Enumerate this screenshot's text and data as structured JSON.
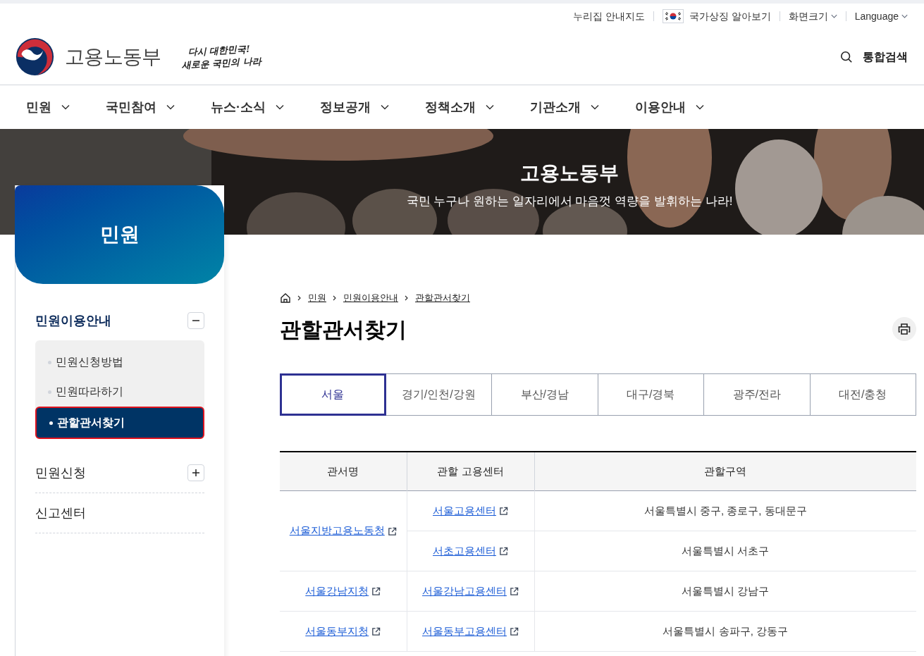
{
  "utility_bar": {
    "links": [
      {
        "label": "누리집 안내지도",
        "kind": "plain"
      },
      {
        "label": "국가상징 알아보기",
        "kind": "flag"
      },
      {
        "label": "화면크기",
        "kind": "dropdown"
      },
      {
        "label": "Language",
        "kind": "dropdown"
      }
    ]
  },
  "header": {
    "logo_text": "고용노동부",
    "slogan": [
      "다시 대한민국!",
      "새로운 국민의 나라"
    ],
    "search_label": "통합검색"
  },
  "nav": [
    "민원",
    "국민참여",
    "뉴스·소식",
    "정보공개",
    "정책소개",
    "기관소개",
    "이용안내"
  ],
  "hero": {
    "title": "고용노동부",
    "subtitle": "국민 누구나 원하는 일자리에서 마음껏 역량을 발휘하는 나라!"
  },
  "sidebar": {
    "title": "민원",
    "items": [
      {
        "label": "민원이용안내",
        "expanded": true,
        "children": [
          {
            "label": "민원신청방법",
            "selected": false
          },
          {
            "label": "민원따라하기",
            "selected": false
          },
          {
            "label": "관할관서찾기",
            "selected": true
          }
        ]
      },
      {
        "label": "민원신청",
        "expanded": false
      },
      {
        "label": "신고센터"
      }
    ]
  },
  "breadcrumb": [
    "민원",
    "민원이용안내",
    "관할관서찾기"
  ],
  "page_title": "관할관서찾기",
  "tabs": [
    {
      "label": "서울",
      "selected": true
    },
    {
      "label": "경기/인천/강원",
      "selected": false
    },
    {
      "label": "부산/경남",
      "selected": false
    },
    {
      "label": "대구/경북",
      "selected": false
    },
    {
      "label": "광주/전라",
      "selected": false
    },
    {
      "label": "대전/충청",
      "selected": false
    }
  ],
  "table": {
    "columns": [
      "관서명",
      "관할 고용센터",
      "관할구역"
    ],
    "rows": [
      {
        "office": "서울지방고용노동청",
        "centers": [
          {
            "name": "서울고용센터",
            "area": "서울특별시 중구, 종로구, 동대문구"
          },
          {
            "name": "서초고용센터",
            "area": "서울특별시 서초구"
          }
        ]
      },
      {
        "office": "서울강남지청",
        "centers": [
          {
            "name": "서울강남고용센터",
            "area": "서울특별시 강남구"
          }
        ]
      },
      {
        "office": "서울동부지청",
        "centers": [
          {
            "name": "서울동부고용센터",
            "area": "서울특별시 송파구, 강동구"
          }
        ]
      }
    ]
  }
}
